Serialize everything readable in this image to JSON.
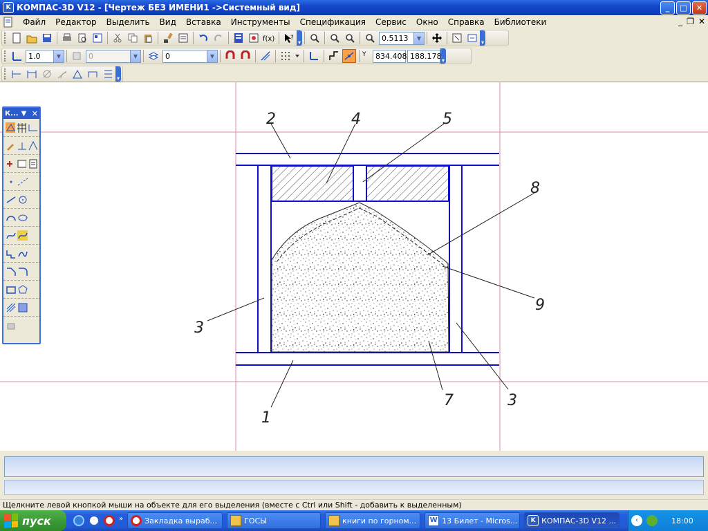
{
  "window": {
    "title": "КОМПАС-3D V12 - [Чертеж БЕЗ ИМЕНИ1 ->Системный вид]",
    "app_icon": "K"
  },
  "menu": [
    "Файл",
    "Редактор",
    "Выделить",
    "Вид",
    "Вставка",
    "Инструменты",
    "Спецификация",
    "Сервис",
    "Окно",
    "Справка",
    "Библиотеки"
  ],
  "toolbar": {
    "zoom_value": "0.5113",
    "line_scale": "1.0",
    "style_value": "0",
    "layer_value": "0",
    "coord_x": "834.408",
    "coord_y": "188.178",
    "coord_label": "Y"
  },
  "palette": {
    "title": "К..."
  },
  "drawing": {
    "labels": [
      "1",
      "2",
      "3",
      "3",
      "4",
      "5",
      "7",
      "8",
      "9"
    ]
  },
  "status": {
    "hint": "Щелкните левой кнопкой мыши на объекте для его выделения (вместе с Ctrl или Shift - добавить к выделенным)"
  },
  "taskbar": {
    "start_label": "пуск",
    "tasks": [
      {
        "label": "Закладка выраб...",
        "icon": "opera-icon"
      },
      {
        "label": "ГОСЫ",
        "icon": "folder-icon"
      },
      {
        "label": "книги по горном...",
        "icon": "folder-icon"
      },
      {
        "label": "13 Билет - Micros...",
        "icon": "word-icon"
      },
      {
        "label": "КОМПАС-3D V12 ...",
        "icon": "kompas-icon"
      }
    ],
    "lang": "EN",
    "clock": "18:00"
  },
  "colors": {
    "titlebar": "#1546c9",
    "drawing_lines": "#1010c8",
    "guide_lines": "#d88aa8"
  }
}
